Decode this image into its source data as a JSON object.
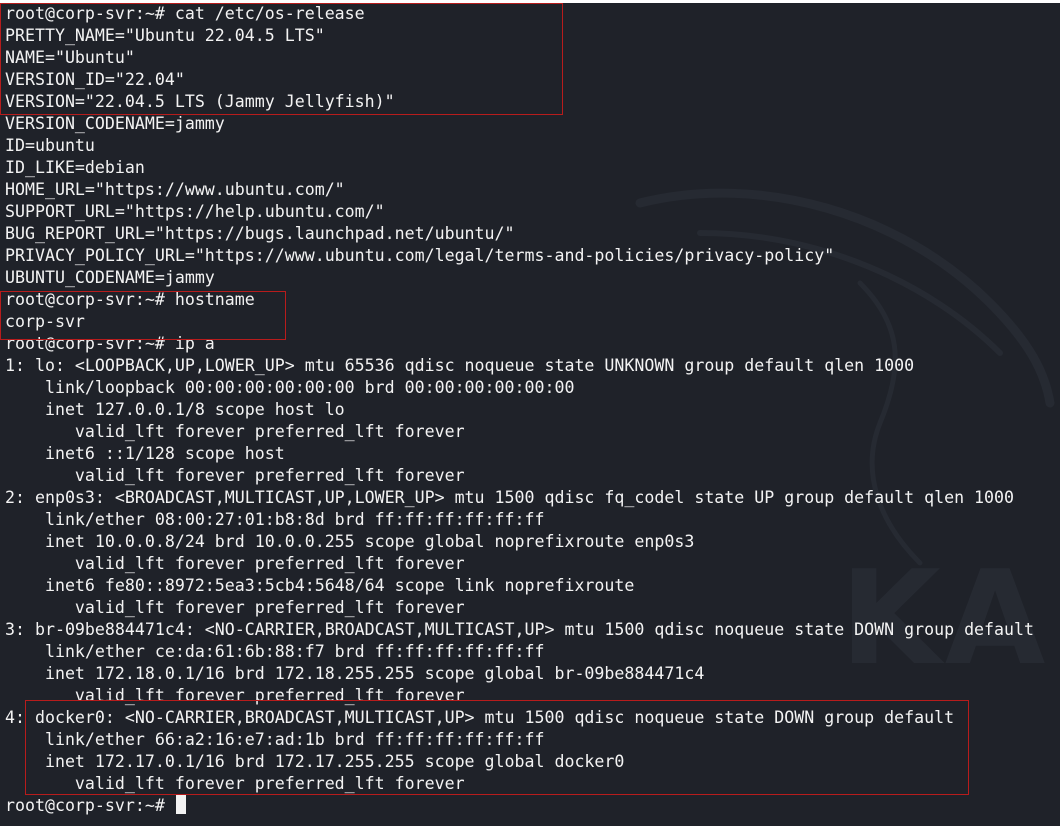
{
  "watermark": {
    "text": "KALI",
    "color": "#2a2d35"
  },
  "terminal": {
    "lines": [
      "root@corp-svr:~# cat /etc/os-release",
      "PRETTY_NAME=\"Ubuntu 22.04.5 LTS\"",
      "NAME=\"Ubuntu\"",
      "VERSION_ID=\"22.04\"",
      "VERSION=\"22.04.5 LTS (Jammy Jellyfish)\"",
      "VERSION_CODENAME=jammy",
      "ID=ubuntu",
      "ID_LIKE=debian",
      "HOME_URL=\"https://www.ubuntu.com/\"",
      "SUPPORT_URL=\"https://help.ubuntu.com/\"",
      "BUG_REPORT_URL=\"https://bugs.launchpad.net/ubuntu/\"",
      "PRIVACY_POLICY_URL=\"https://www.ubuntu.com/legal/terms-and-policies/privacy-policy\"",
      "UBUNTU_CODENAME=jammy",
      "root@corp-svr:~# hostname",
      "corp-svr",
      "root@corp-svr:~# ip a",
      "1: lo: <LOOPBACK,UP,LOWER_UP> mtu 65536 qdisc noqueue state UNKNOWN group default qlen 1000",
      "    link/loopback 00:00:00:00:00:00 brd 00:00:00:00:00:00",
      "    inet 127.0.0.1/8 scope host lo",
      "       valid_lft forever preferred_lft forever",
      "    inet6 ::1/128 scope host",
      "       valid_lft forever preferred_lft forever",
      "2: enp0s3: <BROADCAST,MULTICAST,UP,LOWER_UP> mtu 1500 qdisc fq_codel state UP group default qlen 1000",
      "    link/ether 08:00:27:01:b8:8d brd ff:ff:ff:ff:ff:ff",
      "    inet 10.0.0.8/24 brd 10.0.0.255 scope global noprefixroute enp0s3",
      "       valid_lft forever preferred_lft forever",
      "    inet6 fe80::8972:5ea3:5cb4:5648/64 scope link noprefixroute",
      "       valid_lft forever preferred_lft forever",
      "3: br-09be884471c4: <NO-CARRIER,BROADCAST,MULTICAST,UP> mtu 1500 qdisc noqueue state DOWN group default",
      "    link/ether ce:da:61:6b:88:f7 brd ff:ff:ff:ff:ff:ff",
      "    inet 172.18.0.1/16 brd 172.18.255.255 scope global br-09be884471c4",
      "       valid_lft forever preferred_lft forever",
      "4: docker0: <NO-CARRIER,BROADCAST,MULTICAST,UP> mtu 1500 qdisc noqueue state DOWN group default",
      "    link/ether 66:a2:16:e7:ad:1b brd ff:ff:ff:ff:ff:ff",
      "    inet 172.17.0.1/16 brd 172.17.255.255 scope global docker0",
      "       valid_lft forever preferred_lft forever"
    ],
    "prompt": "root@corp-svr:~# "
  },
  "colors": {
    "background": "#1f2229",
    "text": "#f3f3f3",
    "highlight_box": "#b71c1c"
  }
}
